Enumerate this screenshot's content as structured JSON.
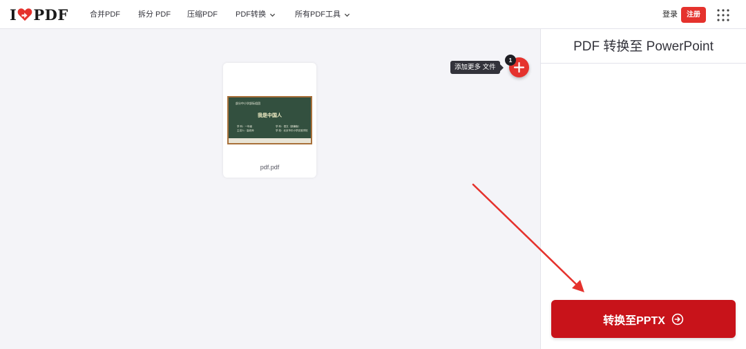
{
  "brand": {
    "logo_left": "I",
    "logo_right": "PDF",
    "accent_color": "#e5322d"
  },
  "nav": {
    "items": [
      {
        "label": "合并PDF",
        "has_dropdown": false
      },
      {
        "label": "拆分 PDF",
        "has_dropdown": false
      },
      {
        "label": "压缩PDF",
        "has_dropdown": false
      },
      {
        "label": "PDF转换",
        "has_dropdown": true
      },
      {
        "label": "所有PDF工具",
        "has_dropdown": true
      }
    ],
    "login_label": "登录",
    "signup_label": "注册",
    "apps_icon": "grid-icon"
  },
  "workspace": {
    "files": [
      {
        "name": "pdf.pdf",
        "thumbnail": {
          "school": "部分中小学部际组团",
          "title": "我是中国人",
          "left_lines": [
            "学  科：一年级",
            "主讲人：高老师"
          ],
          "right_lines": [
            "学  科：语文（部编版）",
            "学  校：北京市中小学实验学校"
          ]
        }
      }
    ],
    "add_more_tooltip": "添加更多 文件",
    "file_count": "1"
  },
  "panel": {
    "title": "PDF 转换至 PowerPoint",
    "convert_label": "转换至PPTX",
    "convert_color": "#c8131a"
  }
}
